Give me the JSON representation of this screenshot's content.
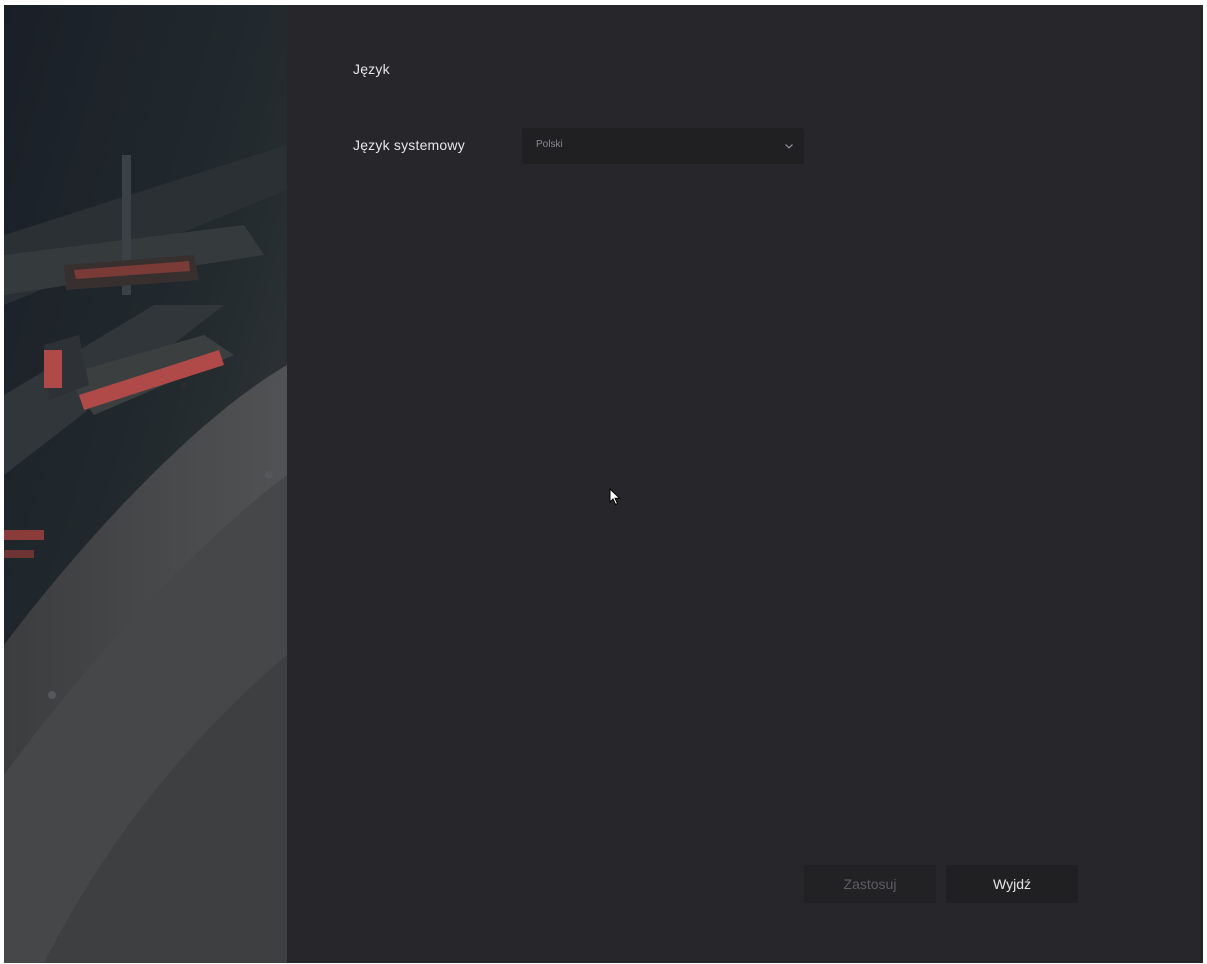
{
  "page": {
    "section_title": "Język"
  },
  "language": {
    "label": "Język systemowy",
    "selected": "Polski"
  },
  "buttons": {
    "apply": "Zastosuj",
    "exit": "Wyjdź"
  },
  "colors": {
    "background": "#27272b",
    "control": "#202023",
    "text": "#e6e6e6",
    "disabled_text": "#5e5e62",
    "accent_red": "#b04a48"
  },
  "icons": {
    "dropdown": "chevron-down-icon",
    "pointer": "mouse-pointer-icon"
  }
}
